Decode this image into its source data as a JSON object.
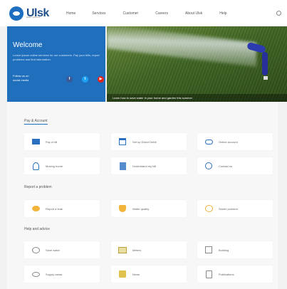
{
  "header": {
    "logo_text": "Ulsk",
    "logo_sub": "water systems",
    "nav": [
      "Home",
      "Services",
      "Customer",
      "Careers",
      "About Ulsk",
      "Help"
    ]
  },
  "welcome": {
    "title": "Welcome",
    "text": "Lorem ipsum online services for our customers. Pay your bills, report problems and find information.",
    "follow_label": "Follow us on",
    "follow_sub": "social media",
    "socials": [
      {
        "name": "facebook-icon",
        "glyph": "f",
        "color": "#3b5998"
      },
      {
        "name": "twitter-icon",
        "glyph": "t",
        "color": "#1da1f2"
      },
      {
        "name": "youtube-icon",
        "glyph": "▶",
        "color": "#e62117"
      }
    ]
  },
  "hero": {
    "caption": "Learn how to save water in your home and garden this summer"
  },
  "sections": [
    {
      "title": "Pay & Account",
      "items": [
        {
          "label": "Pay a bill",
          "icon": "card-icon",
          "cls": "ic-blue-box"
        },
        {
          "label": "Set up Direct Debit",
          "icon": "calendar-icon",
          "cls": "ic-cal"
        },
        {
          "label": "Online account",
          "icon": "cloud-icon",
          "cls": "ic-cloud"
        },
        {
          "label": "Moving home",
          "icon": "person-icon",
          "cls": "ic-person"
        },
        {
          "label": "Understand my bill",
          "icon": "document-icon",
          "cls": "ic-doc"
        },
        {
          "label": "Contact us",
          "icon": "phone-icon",
          "cls": "ic-phone"
        }
      ]
    },
    {
      "title": "Report a problem",
      "items": [
        {
          "label": "Report a leak",
          "icon": "leak-icon",
          "cls": "ic-orange-circ"
        },
        {
          "label": "Water quality",
          "icon": "tap-icon",
          "cls": "ic-orange-tap"
        },
        {
          "label": "Sewer problem",
          "icon": "sewer-icon",
          "cls": "ic-orange-ring"
        }
      ]
    },
    {
      "title": "Help and advice",
      "items": [
        {
          "label": "Save water",
          "icon": "drop-icon",
          "cls": "ic-gray-circ"
        },
        {
          "label": "Meters",
          "icon": "meter-icon",
          "cls": "ic-green-box"
        },
        {
          "label": "Building",
          "icon": "building-icon",
          "cls": "ic-gray-box"
        },
        {
          "label": "Supply areas",
          "icon": "map-icon",
          "cls": "ic-gray-eye"
        },
        {
          "label": "News",
          "icon": "news-icon",
          "cls": "ic-yellow"
        },
        {
          "label": "Publications",
          "icon": "folder-icon",
          "cls": "ic-gray-doc"
        }
      ]
    }
  ]
}
